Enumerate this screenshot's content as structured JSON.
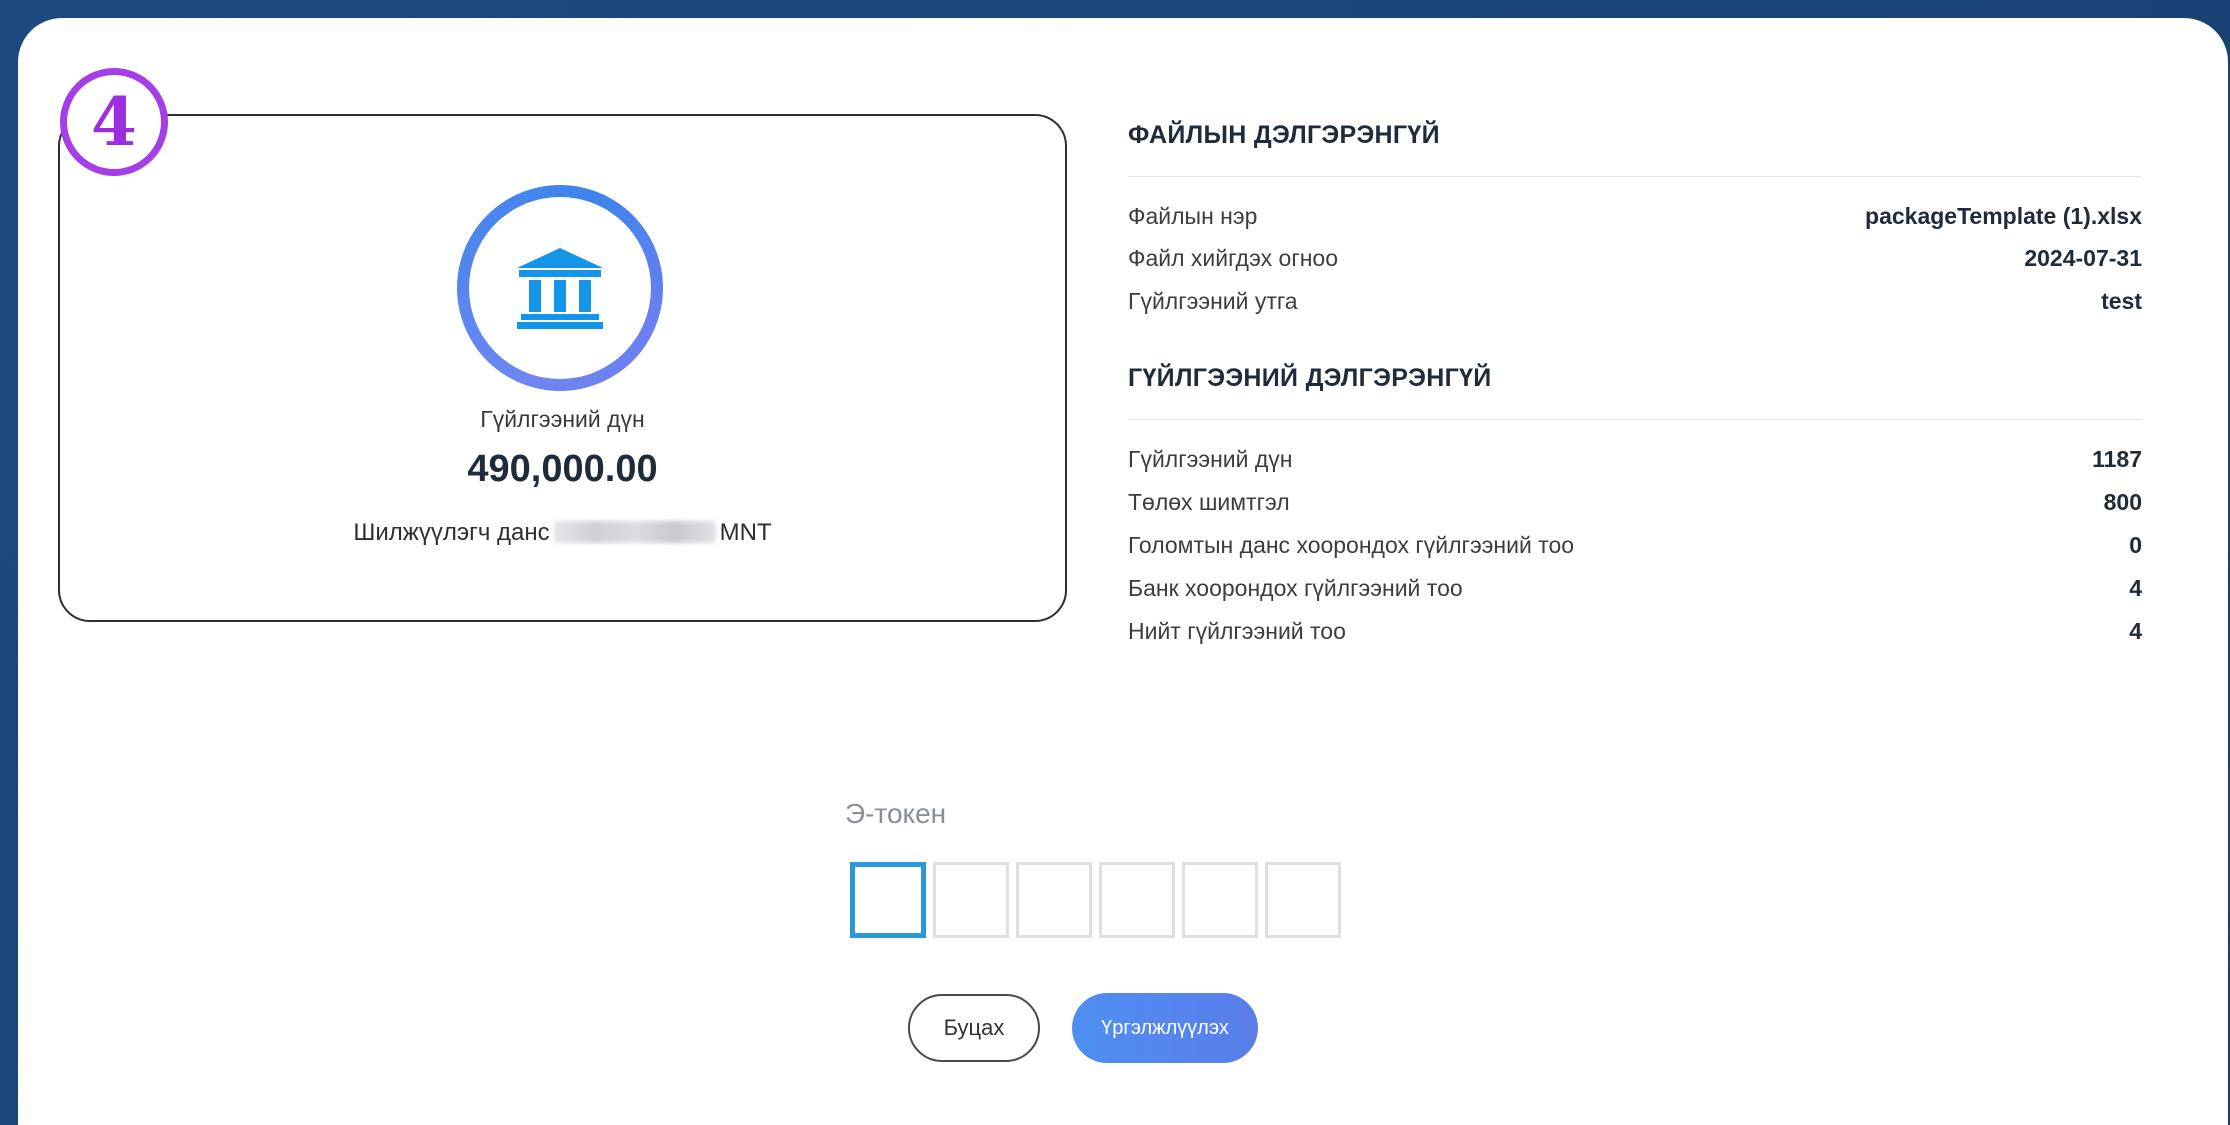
{
  "step": {
    "number": "4"
  },
  "account_card": {
    "amount_label": "Гүйлгээний дүн",
    "amount_value": "490,000.00",
    "sender_account_label": "Шилжүүлэгч данс",
    "currency": "MNT",
    "icon": "bank-icon"
  },
  "file_details": {
    "title": "ФАЙЛЫН ДЭЛГЭРЭНГҮЙ",
    "rows": [
      {
        "label": "Файлын нэр",
        "value": "packageTemplate (1).xlsx"
      },
      {
        "label": "Файл хийгдэх огноо",
        "value": "2024-07-31"
      },
      {
        "label": "Гүйлгээний утга",
        "value": "test"
      }
    ]
  },
  "transaction_details": {
    "title": "ГҮЙЛГЭЭНИЙ ДЭЛГЭРЭНГҮЙ",
    "rows": [
      {
        "label": "Гүйлгээний дүн",
        "value": "1187"
      },
      {
        "label": "Төлөх шимтгэл",
        "value": "800"
      },
      {
        "label": "Голомтын данс хоорондох гүйлгээний тоо",
        "value": "0"
      },
      {
        "label": "Банк хоорондох гүйлгээний тоо",
        "value": "4"
      },
      {
        "label": "Нийт гүйлгээний тоо",
        "value": "4"
      }
    ]
  },
  "token": {
    "label": "Э-токен",
    "digits": [
      "",
      "",
      "",
      "",
      "",
      ""
    ]
  },
  "buttons": {
    "back_label": "Буцах",
    "continue_label": "Үргэлжлүүлэх"
  },
  "colors": {
    "accent": "#4e8ff2",
    "badge": "#a63ee8",
    "token_active": "#2a98d8"
  }
}
